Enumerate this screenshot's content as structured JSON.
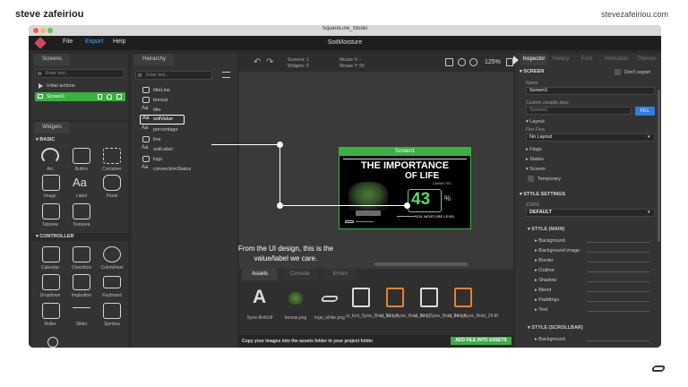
{
  "page": {
    "author": "steve zafeiriou",
    "site": "stevezafeiriou.com"
  },
  "window": {
    "title": "SquareLine_Studio",
    "project": "SoilMoisture",
    "menus": [
      "File",
      "Export",
      "Help"
    ]
  },
  "screens_panel": {
    "tab": "Screens",
    "search_placeholder": "Enter text...",
    "initial_actions": "Initial actions",
    "screen_item": "Screen1"
  },
  "widgets_panel": {
    "tab": "Widgets",
    "basic_header": "BASIC",
    "basic": [
      "Arc",
      "Button",
      "Container",
      "Image",
      "Label",
      "Panel",
      "Tabview",
      "Textarea"
    ],
    "controller_header": "CONTROLLER",
    "controller": [
      "Calendar",
      "Checkbox",
      "Colorwheel",
      "Dropdown",
      "Imgbutton",
      "Keyboard",
      "Roller",
      "Slider",
      "Spinbox"
    ]
  },
  "hierarchy": {
    "tab": "Hierarchy",
    "search_placeholder": "Enter text...",
    "items": [
      "titleLine",
      "bonzai",
      "title",
      "soilValue",
      "percentage",
      "line",
      "soilLabel",
      "logo",
      "connectionStatus"
    ]
  },
  "canvas_toolbar": {
    "screens_label": "Screens:",
    "screens_value": "1",
    "widgets_label": "Widgets:",
    "widgets_value": "9",
    "mouse_x_label": "Mouse X:",
    "mouse_x_value": "-",
    "mouse_y_label": "Mouse Y:",
    "mouse_y_value": "55",
    "zoom": "125%"
  },
  "screen_preview": {
    "name": "Screen1",
    "title_line1": "THE IMPORTANCE",
    "title_line2": "OF LIFE",
    "brand_small": "CAVIAR-TEC",
    "value": "43",
    "unit": "%",
    "label": "SOIL MOISTURE LEVEL"
  },
  "annotation": {
    "line1": "From the UI design, this is the",
    "line2": "value/label we care."
  },
  "assets": {
    "tabs": [
      "Assets",
      "Console",
      "Errors"
    ],
    "files": [
      {
        "name": "Syne-Bold.ttf",
        "kind": "font"
      },
      {
        "name": "bonzai.png",
        "kind": "image"
      },
      {
        "name": "logo_white.png",
        "kind": "logo"
      },
      {
        "name": "ui_font_Syne_Bold_10.bin",
        "kind": "file-white"
      },
      {
        "name": "ui_font_Syne_Bold_10.ttf",
        "kind": "file-orange"
      },
      {
        "name": "ui_font_Syne_Bold_24.bin",
        "kind": "file-white"
      },
      {
        "name": "ui_font_Syne_Bold_24.ttf",
        "kind": "file-orange"
      }
    ],
    "footer_text": "Copy your images into the assets folder in your project folder",
    "add_button": "ADD FILE INTO ASSETS"
  },
  "inspector": {
    "tabs": [
      "Inspector",
      "History",
      "Font",
      "Animation",
      "Themes"
    ],
    "screen_header": "SCREEN",
    "dont_export": "Don't export",
    "name_label": "Name",
    "name_value": "Screen1",
    "custom_alias_label": "Custom variable alias",
    "alias_placeholder": "Screen1",
    "fill_button": "FILL",
    "layout_label": "Layout",
    "flex_flow_label": "Flex Flow",
    "flex_flow_value": "No Layout",
    "flags": "Flags",
    "states": "States",
    "screen_sub": "Screen",
    "temporary": "Temporary",
    "style_settings": "STYLE SETTINGS",
    "state_label": "STATE",
    "state_value": "DEFAULT",
    "style_main": "STYLE (MAIN)",
    "style_rows": [
      "Background",
      "Background image",
      "Border",
      "Outline",
      "Shadow",
      "Blend",
      "Paddings",
      "Text"
    ],
    "style_scrollbar": "STYLE (SCROLLBAR)",
    "scrollbar_rows": [
      "Background"
    ]
  },
  "colors": {
    "accent_green": "#3cb043",
    "value_green": "#59d96b",
    "fill_blue": "#2f7fe0",
    "orange": "#e8822a",
    "export_blue": "#4ea3ff"
  }
}
